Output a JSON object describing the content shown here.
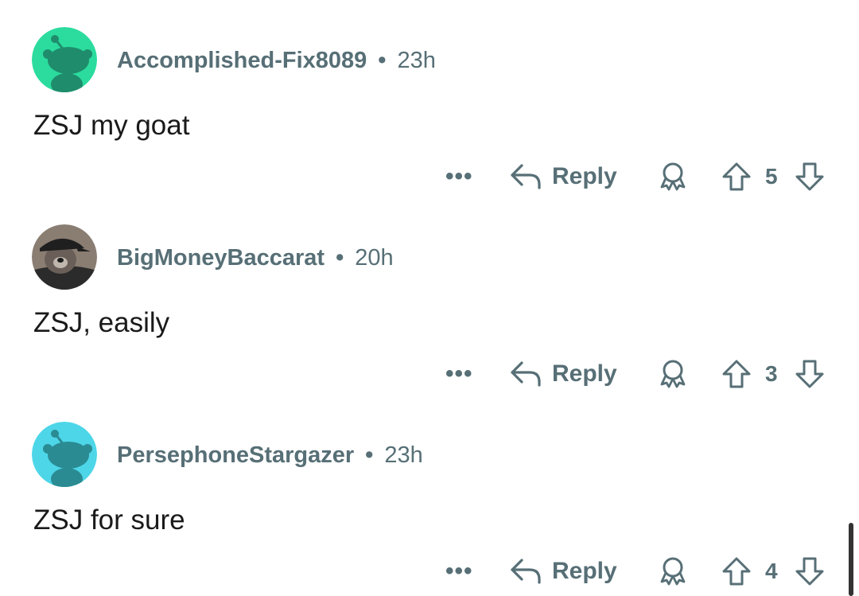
{
  "comments": [
    {
      "username": "Accomplished-Fix8089",
      "separator": "•",
      "time": "23h",
      "text": "ZSJ my goat",
      "more_label": "•••",
      "reply_label": "Reply",
      "score": "5",
      "avatar": {
        "kind": "snoo",
        "bg": "#2bdc9e",
        "fg": "#1f8c6c"
      }
    },
    {
      "username": "BigMoneyBaccarat",
      "separator": "•",
      "time": "20h",
      "text": "ZSJ, easily",
      "more_label": "•••",
      "reply_label": "Reply",
      "score": "3",
      "avatar": {
        "kind": "photo",
        "bg": "#7a6f66",
        "fg": "#2a2a2a"
      }
    },
    {
      "username": "PersephoneStargazer",
      "separator": "•",
      "time": "23h",
      "text": "ZSJ for sure",
      "more_label": "•••",
      "reply_label": "Reply",
      "score": "4",
      "avatar": {
        "kind": "snoo",
        "bg": "#4dd6e8",
        "fg": "#2a8b93"
      }
    }
  ],
  "colors": {
    "meta_text": "#576f76",
    "body_text": "#1a1a1b"
  }
}
